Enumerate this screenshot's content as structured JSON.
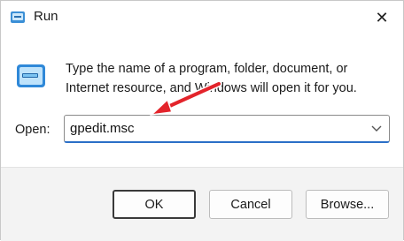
{
  "window": {
    "title": "Run",
    "close_glyph": "✕"
  },
  "dialog": {
    "description": "Type the name of a program, folder, document, or Internet resource, and Windows will open it for you.",
    "open_label": "Open:",
    "open_value": "gpedit.msc"
  },
  "buttons": {
    "ok": "OK",
    "cancel": "Cancel",
    "browse": "Browse..."
  },
  "colors": {
    "accent": "#2b6fc7",
    "arrow": "#e3242b"
  }
}
